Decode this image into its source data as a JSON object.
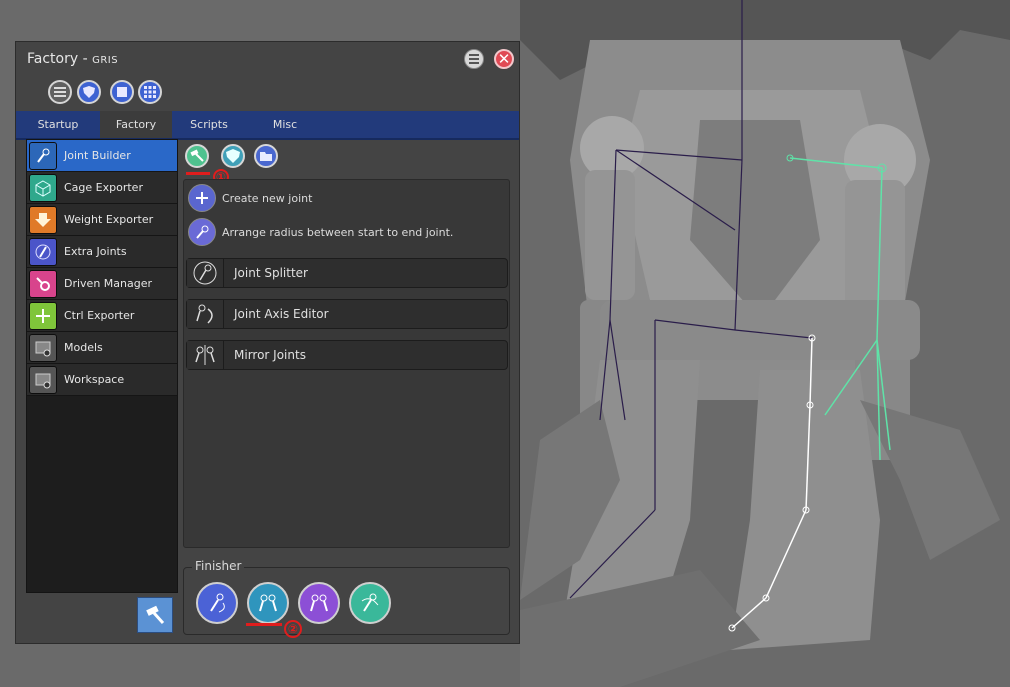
{
  "window": {
    "title": "Factory - ",
    "subtitle": "GRIS"
  },
  "toolbar": {
    "icons": [
      "list-icon",
      "shield-icon",
      "square-icon",
      "grid-icon"
    ]
  },
  "tabs": [
    {
      "label": "Startup",
      "active": false
    },
    {
      "label": "Factory",
      "active": true
    },
    {
      "label": "Scripts",
      "active": false
    },
    {
      "label": "Misc",
      "active": false
    }
  ],
  "sidebar": {
    "items": [
      {
        "label": "Joint Builder",
        "icon": "joint-icon",
        "color": "#2c67b8",
        "active": true
      },
      {
        "label": "Cage Exporter",
        "icon": "cube-icon",
        "color": "#2fa88c",
        "active": false
      },
      {
        "label": "Weight Exporter",
        "icon": "download-arrow-icon",
        "color": "#e07a28",
        "active": false
      },
      {
        "label": "Extra Joints",
        "icon": "joint-icon",
        "color": "#4b55c9",
        "active": false
      },
      {
        "label": "Driven Manager",
        "icon": "gear-icon",
        "color": "#d8448c",
        "active": false
      },
      {
        "label": "Ctrl Exporter",
        "icon": "arrows-icon",
        "color": "#7fc53a",
        "active": false
      },
      {
        "label": "Models",
        "icon": "folder-icon",
        "color": "#555555",
        "active": false
      },
      {
        "label": "Workspace",
        "icon": "folder-icon",
        "color": "#555555",
        "active": false
      }
    ]
  },
  "content": {
    "mode_buttons": [
      {
        "icon": "hammer-icon",
        "color": "#4fc28f"
      },
      {
        "icon": "shield-icon",
        "color": "#3fa0b8"
      },
      {
        "icon": "folder-icon",
        "color": "#4a68d0"
      }
    ],
    "actions": [
      {
        "label": "Create new joint",
        "icon": "plus-icon",
        "color": "#5a66cf"
      },
      {
        "label": "Arrange radius between start to end joint.",
        "icon": "radius-icon",
        "color": "#6a6ad6"
      }
    ],
    "tools": [
      {
        "label": "Joint Splitter",
        "icon": "joint-splitter-icon"
      },
      {
        "label": "Joint Axis Editor",
        "icon": "joint-axis-icon"
      },
      {
        "label": "Mirror Joints",
        "icon": "mirror-joints-icon"
      }
    ]
  },
  "finisher": {
    "title": "Finisher",
    "buttons": [
      {
        "icon": "joint-chain-icon",
        "color": "#4b62d6"
      },
      {
        "icon": "joint-pair-icon",
        "color": "#2f95bd"
      },
      {
        "icon": "joint-pair-icon",
        "color": "#8c4fd6"
      },
      {
        "icon": "joint-loop-icon",
        "color": "#3ab89a"
      }
    ]
  },
  "annotations": {
    "marker1": "①",
    "marker2": "②",
    "color": "#e01d1d"
  },
  "viewport": {
    "background": "#6a6a6a",
    "rig_colors": {
      "left_arm": "#2a1d4a",
      "right_arm": "#5fe3a8",
      "leg": "#ffffff"
    }
  }
}
